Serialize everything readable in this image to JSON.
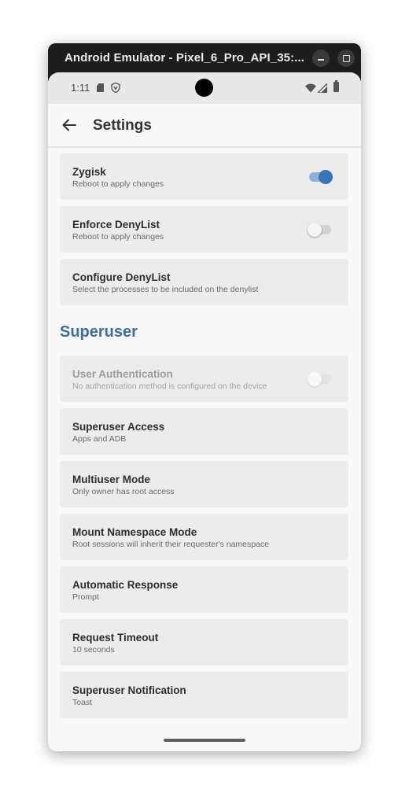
{
  "window": {
    "title": "Android Emulator - Pixel_6_Pro_API_35:..."
  },
  "statusbar": {
    "time": "1:11"
  },
  "appbar": {
    "title": "Settings"
  },
  "section": {
    "superuser": "Superuser"
  },
  "items": [
    {
      "title": "Zygisk",
      "subtitle": "Reboot to apply changes",
      "toggle": "on"
    },
    {
      "title": "Enforce DenyList",
      "subtitle": "Reboot to apply changes",
      "toggle": "off"
    },
    {
      "title": "Configure DenyList",
      "subtitle": "Select the processes to be included on the denylist"
    },
    {
      "title": "User Authentication",
      "subtitle": "No authentication method is configured on the device",
      "toggle": "off",
      "enabled": false
    },
    {
      "title": "Superuser Access",
      "subtitle": "Apps and ADB"
    },
    {
      "title": "Multiuser Mode",
      "subtitle": "Only owner has root access"
    },
    {
      "title": "Mount Namespace Mode",
      "subtitle": "Root sessions will inherit their requester's namespace"
    },
    {
      "title": "Automatic Response",
      "subtitle": "Prompt"
    },
    {
      "title": "Request Timeout",
      "subtitle": "10 seconds"
    },
    {
      "title": "Superuser Notification",
      "subtitle": "Toast"
    }
  ],
  "colors": {
    "accent": "#3c6ea6",
    "toggle_on": "#3a74b8",
    "card_bg": "#ececec",
    "screen_bg": "#f8f8f8"
  }
}
